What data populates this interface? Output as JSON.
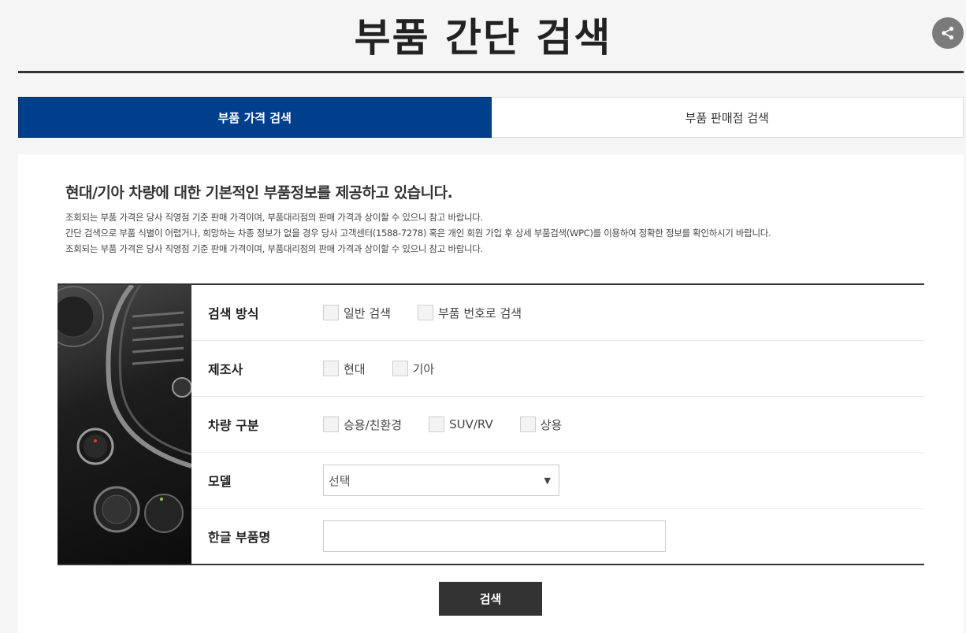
{
  "header": {
    "title": "부품 간단 검색",
    "share_icon": "share-icon"
  },
  "tabs": [
    {
      "label": "부품 가격 검색",
      "active": true
    },
    {
      "label": "부품 판매점 검색",
      "active": false
    }
  ],
  "intro": {
    "headline": "현대/기아 차량에 대한 기본적인 부품정보를 제공하고 있습니다.",
    "notes": [
      "조회되는 부품 가격은 당사 직영점 기준 판매 가격이며, 부품대리점의 판매 가격과 상이할 수 있으니 참고 바랍니다.",
      "간단 검색으로 부품 식별이 어렵거나, 희망하는 차종 정보가 없을 경우 당사 고객센터(1588-7278) 혹은 개인 회원 가입 후 상세 부품검색(WPC)를 이용하여 정확한 정보를 확인하시기 바랍니다.",
      "조회되는 부품 가격은 당사 직영점 기준 판매 가격이며, 부품대리점의 판매 가격과 상이할 수 있으니 참고 바랍니다."
    ]
  },
  "form": {
    "search_method": {
      "label": "검색 방식",
      "options": [
        "일반 검색",
        "부품 번호로 검색"
      ]
    },
    "manufacturer": {
      "label": "제조사",
      "options": [
        "현대",
        "기아"
      ]
    },
    "vehicle_type": {
      "label": "차량 구분",
      "options": [
        "승용/친환경",
        "SUV/RV",
        "상용"
      ]
    },
    "model": {
      "label": "모델",
      "selected": "선택"
    },
    "part_name": {
      "label": "한글 부품명",
      "value": ""
    }
  },
  "search_button": {
    "label": "검색"
  },
  "colors": {
    "accent": "#003f8c",
    "button": "#333333",
    "share": "#7b7b7b"
  }
}
